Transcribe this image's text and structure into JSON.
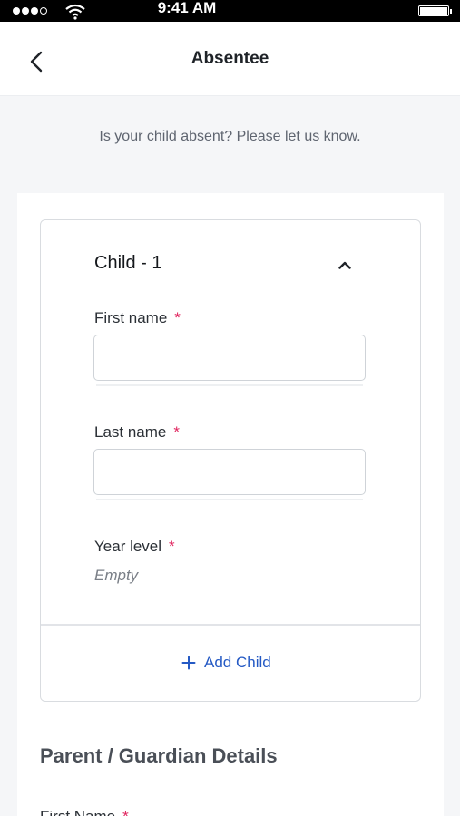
{
  "status_bar": {
    "time": "9:41 AM",
    "signal_filled": 3,
    "signal_empty": 1
  },
  "nav": {
    "back_icon": "chevron-left-icon",
    "title": "Absentee"
  },
  "intro": "Is your child absent? Please let us know.",
  "child": {
    "title": "Child - 1",
    "collapse_icon": "chevron-up-icon",
    "fields": {
      "first_name": {
        "label": "First name",
        "required_mark": "*",
        "value": ""
      },
      "last_name": {
        "label": "Last name",
        "required_mark": "*",
        "value": ""
      },
      "year_level": {
        "label": "Year level",
        "required_mark": "*",
        "value": "Empty"
      }
    },
    "add_child": {
      "icon": "plus-icon",
      "label": "Add Child"
    }
  },
  "parent_section": {
    "heading": "Parent / Guardian Details",
    "first_field_label": "First Name",
    "required_mark": "*"
  },
  "colors": {
    "accent": "#2459c4",
    "required": "#e0245e",
    "background": "#f5f6f8"
  }
}
